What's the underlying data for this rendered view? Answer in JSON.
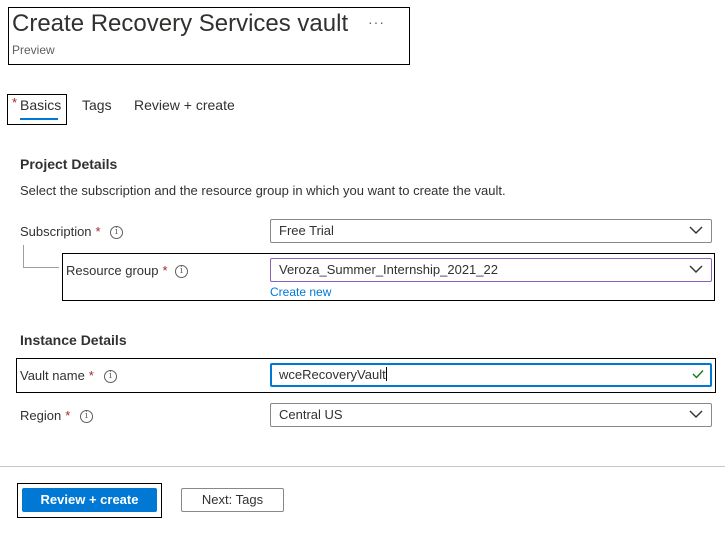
{
  "header": {
    "title": "Create Recovery Services vault",
    "more": "···",
    "subtitle": "Preview"
  },
  "tabs": [
    {
      "label": "Basics",
      "active": true,
      "required_marker": "*"
    },
    {
      "label": "Tags",
      "active": false
    },
    {
      "label": "Review + create",
      "active": false
    }
  ],
  "project_details": {
    "heading": "Project Details",
    "description": "Select the subscription and the resource group in which you want to create the vault.",
    "subscription": {
      "label": "Subscription",
      "required": "*",
      "info_icon": "i",
      "value": "Free Trial"
    },
    "resource_group": {
      "label": "Resource group",
      "required": "*",
      "info_icon": "i",
      "value": "Veroza_Summer_Internship_2021_22",
      "create_new_link": "Create new"
    }
  },
  "instance_details": {
    "heading": "Instance Details",
    "vault_name": {
      "label": "Vault name",
      "required": "*",
      "info_icon": "i",
      "value": "wceRecoveryVault",
      "valid": true
    },
    "region": {
      "label": "Region",
      "required": "*",
      "info_icon": "i",
      "value": "Central US"
    }
  },
  "footer": {
    "primary_button": "Review + create",
    "secondary_button": "Next: Tags"
  },
  "colors": {
    "accent": "#0078d4",
    "required": "#a4262c",
    "valid_check": "#107c10",
    "selected_border": "#8764b8"
  }
}
